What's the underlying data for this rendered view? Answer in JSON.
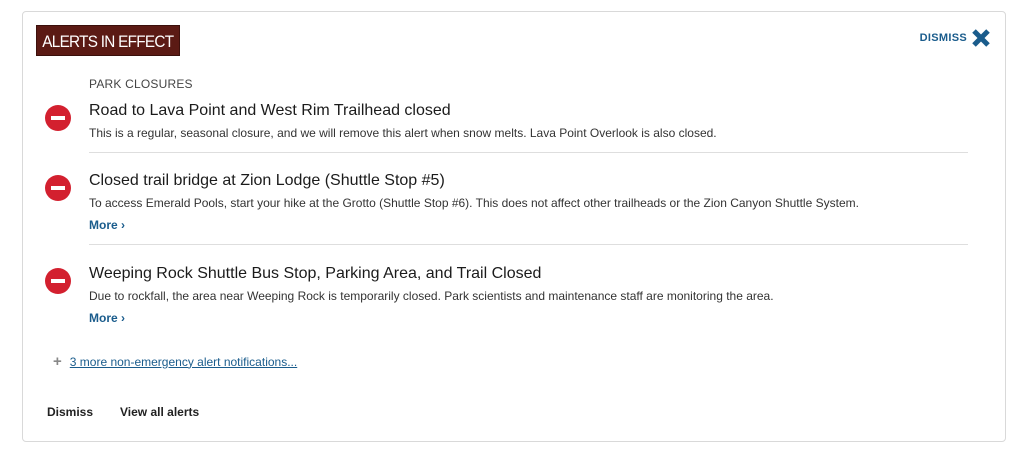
{
  "header": {
    "badge": "ALERTS IN EFFECT",
    "dismiss_label": "DISMISS"
  },
  "category": "PARK CLOSURES",
  "alerts": [
    {
      "title": "Road to Lava Point and West Rim Trailhead closed",
      "description": "This is a regular, seasonal closure, and we will remove this alert when snow melts. Lava Point Overlook is also closed.",
      "more": ""
    },
    {
      "title": "Closed trail bridge at Zion Lodge (Shuttle Stop #5)",
      "description": "To access Emerald Pools, start your hike at the Grotto (Shuttle Stop #6). This does not affect other trailheads or the Zion Canyon Shuttle System.",
      "more": "More ›"
    },
    {
      "title": "Weeping Rock Shuttle Bus Stop, Parking Area, and Trail Closed",
      "description": "Due to rockfall, the area near Weeping Rock is temporarily closed. Park scientists and maintenance staff are monitoring the area.",
      "more": "More ›"
    }
  ],
  "more_notifications": {
    "icon": "plus-icon",
    "label": "3 more non-emergency alert notifications..."
  },
  "footer": {
    "dismiss": "Dismiss",
    "view_all": "View all alerts"
  },
  "colors": {
    "badge_bg": "#5b1a14",
    "alert_icon": "#d3202f",
    "link": "#1a5c8c"
  },
  "icons": {
    "alert": "closure-icon",
    "dismiss": "close-x-icon"
  }
}
